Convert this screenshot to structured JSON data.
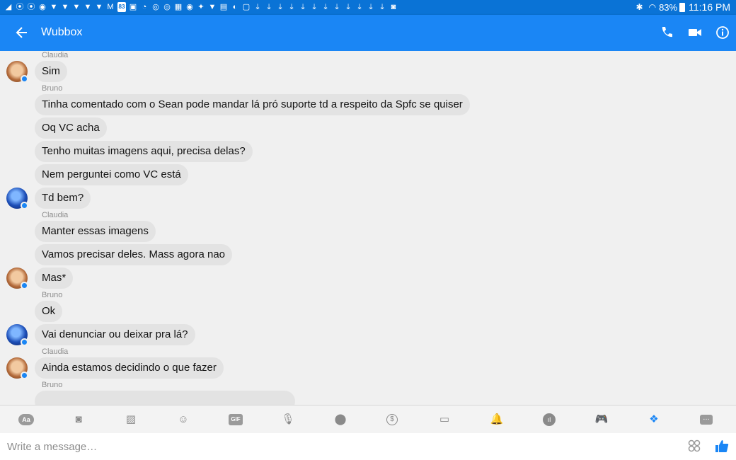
{
  "status_bar": {
    "notification_icons": [
      {
        "name": "signal-icon",
        "glyph": "◢"
      },
      {
        "name": "messenger-icon",
        "glyph": "⦿"
      },
      {
        "name": "messenger-icon",
        "glyph": "⦿"
      },
      {
        "name": "app-icon",
        "glyph": "◉"
      },
      {
        "name": "twitter-icon",
        "glyph": "▼"
      },
      {
        "name": "twitter-icon",
        "glyph": "▼"
      },
      {
        "name": "twitter-icon",
        "glyph": "▼"
      },
      {
        "name": "twitter-icon",
        "glyph": "▼"
      },
      {
        "name": "twitter-icon",
        "glyph": "▼"
      },
      {
        "name": "gmail-icon",
        "glyph": "M"
      },
      {
        "name": "badge-icon",
        "glyph": "83"
      },
      {
        "name": "image-icon",
        "glyph": "▣"
      },
      {
        "name": "clock-icon",
        "glyph": "◔"
      },
      {
        "name": "chrome-icon",
        "glyph": "◎"
      },
      {
        "name": "chrome-icon",
        "glyph": "◎"
      },
      {
        "name": "calendar-icon",
        "glyph": "▦"
      },
      {
        "name": "messenger-icon",
        "glyph": "◉"
      },
      {
        "name": "game-icon",
        "glyph": "✦"
      },
      {
        "name": "twitter-icon",
        "glyph": "▼"
      },
      {
        "name": "grid-icon",
        "glyph": "▤"
      },
      {
        "name": "sync-icon",
        "glyph": "◐"
      },
      {
        "name": "screen-icon",
        "glyph": "▢"
      },
      {
        "name": "download-icon",
        "glyph": "⤓"
      },
      {
        "name": "download-icon",
        "glyph": "⤓"
      },
      {
        "name": "download-icon",
        "glyph": "⤓"
      },
      {
        "name": "download-icon",
        "glyph": "⤓"
      },
      {
        "name": "download-icon",
        "glyph": "⤓"
      },
      {
        "name": "download-icon",
        "glyph": "⤓"
      },
      {
        "name": "download-icon",
        "glyph": "⤓"
      },
      {
        "name": "download-icon",
        "glyph": "⤓"
      },
      {
        "name": "download-icon",
        "glyph": "⤓"
      },
      {
        "name": "download-icon",
        "glyph": "⤓"
      },
      {
        "name": "download-icon",
        "glyph": "⤓"
      },
      {
        "name": "download-icon",
        "glyph": "⤓"
      },
      {
        "name": "photo-icon",
        "glyph": "◙"
      }
    ],
    "battery": "83%",
    "time": "11:16 PM"
  },
  "header": {
    "title": "Wubbox"
  },
  "messages": [
    {
      "type": "name",
      "text": "Claudia"
    },
    {
      "type": "bubble",
      "text": "Sim",
      "avatar": "claudia"
    },
    {
      "type": "name",
      "text": "Bruno"
    },
    {
      "type": "bubble",
      "text": "Tinha comentado com o Sean pode mandar lá pró suporte td a respeito da Spfc se quiser"
    },
    {
      "type": "bubble",
      "text": "Oq VC acha"
    },
    {
      "type": "bubble",
      "text": "Tenho muitas imagens aqui, precisa delas?"
    },
    {
      "type": "bubble",
      "text": "Nem perguntei como VC está"
    },
    {
      "type": "bubble",
      "text": "Td bem?",
      "avatar": "bruno"
    },
    {
      "type": "name",
      "text": "Claudia"
    },
    {
      "type": "bubble",
      "text": "Manter essas imagens"
    },
    {
      "type": "bubble",
      "text": "Vamos precisar deles. Mass agora nao"
    },
    {
      "type": "bubble",
      "text": "Mas*",
      "avatar": "claudia"
    },
    {
      "type": "name",
      "text": "Bruno"
    },
    {
      "type": "bubble",
      "text": "Ok"
    },
    {
      "type": "bubble",
      "text": "Vai denunciar ou deixar pra lá?",
      "avatar": "bruno"
    },
    {
      "type": "name",
      "text": "Claudia"
    },
    {
      "type": "bubble",
      "text": "Ainda estamos decidindo o que fazer",
      "avatar": "claudia"
    },
    {
      "type": "name",
      "text": "Bruno"
    }
  ],
  "toolbar": {
    "tools": [
      {
        "name": "text-style-icon",
        "glyph": "Aa",
        "style": "pill"
      },
      {
        "name": "camera-icon",
        "glyph": "◙",
        "style": ""
      },
      {
        "name": "gallery-icon",
        "glyph": "▨",
        "style": ""
      },
      {
        "name": "emoji-icon",
        "glyph": "☺",
        "style": ""
      },
      {
        "name": "gif-icon",
        "glyph": "GIF",
        "style": "gif"
      },
      {
        "name": "microphone-icon",
        "glyph": "🎙",
        "style": ""
      },
      {
        "name": "location-icon",
        "glyph": "⬤",
        "style": ""
      },
      {
        "name": "payment-icon",
        "glyph": "$",
        "style": "dollar"
      },
      {
        "name": "car-icon",
        "glyph": "▭",
        "style": ""
      },
      {
        "name": "bell-icon",
        "glyph": "🔔",
        "style": ""
      },
      {
        "name": "poll-icon",
        "glyph": "ıl",
        "style": "solid-circle"
      },
      {
        "name": "game-icon",
        "glyph": "🎮",
        "style": ""
      },
      {
        "name": "dropbox-icon",
        "glyph": "❖",
        "style": "active"
      },
      {
        "name": "more-icon",
        "glyph": "…",
        "style": "more"
      }
    ]
  },
  "composer": {
    "placeholder": "Write a message…"
  },
  "colors": {
    "accent": "#1a86f5",
    "status_bar": "#0a73d6",
    "bubble": "#e3e3e3",
    "background": "#f0f0f0"
  }
}
